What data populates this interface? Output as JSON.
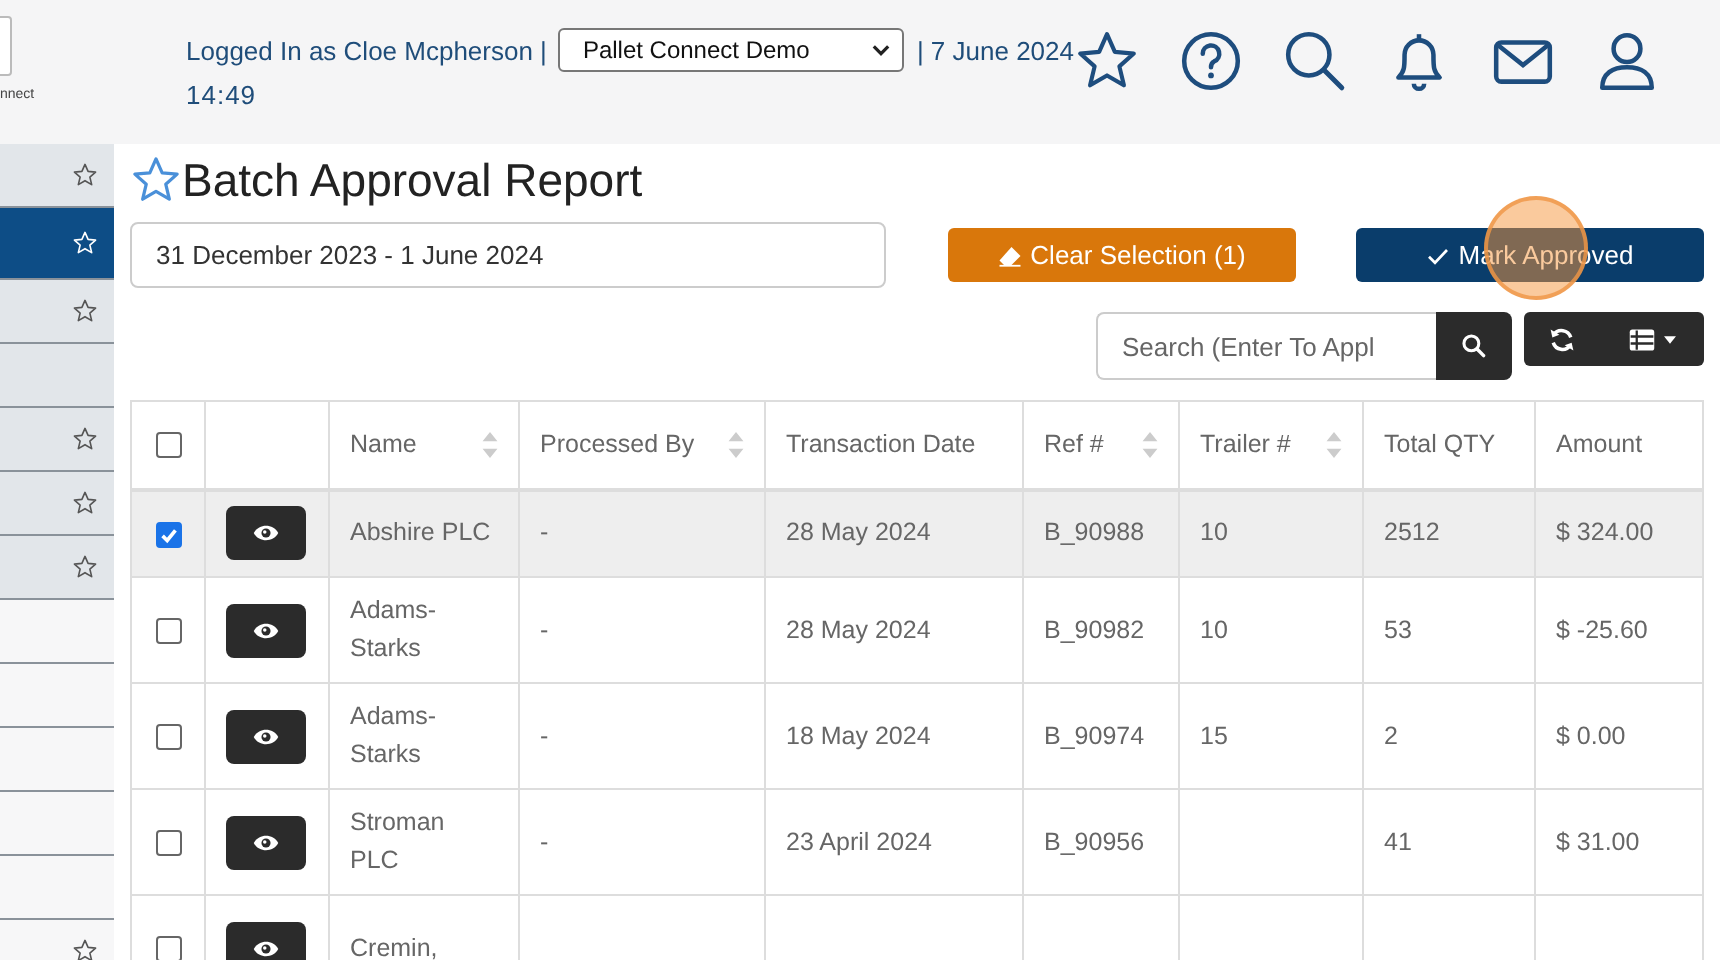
{
  "header": {
    "logo_text": "nnect",
    "user_text": "Logged In as Cloe Mcpherson |",
    "company_select": {
      "value": "Pallet Connect Demo"
    },
    "date_text": "| 7 June 2024",
    "time_text": "14:49",
    "icons": [
      {
        "kind": "star"
      },
      {
        "kind": "help"
      },
      {
        "kind": "search"
      },
      {
        "kind": "bell"
      },
      {
        "kind": "mail"
      },
      {
        "kind": "user"
      }
    ]
  },
  "sidebar": {
    "items": [
      {
        "kind": "star",
        "selected": false
      },
      {
        "kind": "star",
        "selected": true
      },
      {
        "kind": "star",
        "selected": false
      },
      {
        "kind": "plain",
        "selected": false
      },
      {
        "kind": "star",
        "selected": false
      },
      {
        "kind": "star",
        "selected": false
      },
      {
        "kind": "star",
        "selected": false
      },
      {
        "kind": "plain",
        "selected": false
      },
      {
        "kind": "plain",
        "selected": false
      },
      {
        "kind": "plain",
        "selected": false
      },
      {
        "kind": "plain",
        "selected": false
      },
      {
        "kind": "plain",
        "selected": false
      },
      {
        "kind": "star",
        "selected": false
      }
    ]
  },
  "page": {
    "title": "Batch Approval Report",
    "date_range": {
      "value": "31 December 2023 - 1 June 2024"
    },
    "clear_button": "Clear Selection (1)",
    "approve_button": "Mark Approved",
    "search": {
      "placeholder": "Search (Enter To Appl"
    }
  },
  "table": {
    "select_all_checked": false,
    "columns": [
      {
        "kind": "check"
      },
      {
        "kind": "view"
      },
      {
        "label": "Name",
        "kind": "text",
        "sortable": true
      },
      {
        "label": "Processed By",
        "kind": "text",
        "sortable": true
      },
      {
        "label": "Transaction Date",
        "kind": "text",
        "sortable": false
      },
      {
        "label": "Ref #",
        "kind": "text",
        "sortable": true
      },
      {
        "label": "Trailer #",
        "kind": "text",
        "sortable": true
      },
      {
        "label": "Total QTY",
        "kind": "text",
        "sortable": false
      },
      {
        "label": "Amount",
        "kind": "text",
        "sortable": false
      }
    ],
    "rows": [
      {
        "selected": true,
        "cells": [
          "",
          "",
          "Abshire PLC",
          "-",
          "28 May 2024",
          "B_90988",
          "10",
          "2512",
          "$ 324.00"
        ]
      },
      {
        "selected": false,
        "cells": [
          "",
          "",
          "Adams-\nStarks",
          "-",
          "28 May 2024",
          "B_90982",
          "10",
          "53",
          "$ -25.60"
        ]
      },
      {
        "selected": false,
        "cells": [
          "",
          "",
          "Adams-\nStarks",
          "-",
          "18 May 2024",
          "B_90974",
          "15",
          "2",
          "$ 0.00"
        ]
      },
      {
        "selected": false,
        "cells": [
          "",
          "",
          "Stroman\nPLC",
          "-",
          "23 April 2024",
          "B_90956",
          "",
          "41",
          "$ 31.00"
        ]
      },
      {
        "selected": false,
        "cells": [
          "",
          "",
          "Cremin,",
          "",
          "",
          "",
          "",
          "",
          ""
        ]
      }
    ]
  }
}
